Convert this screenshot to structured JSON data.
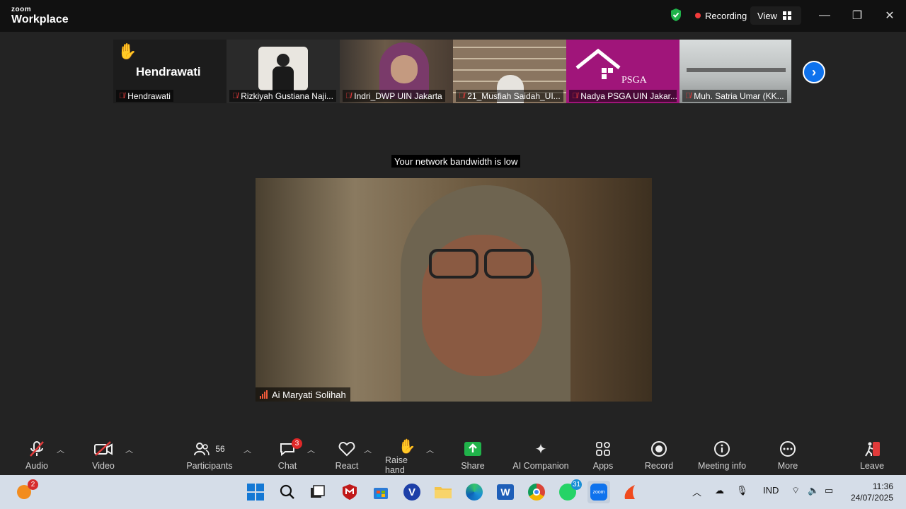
{
  "titlebar": {
    "logo_small": "zoom",
    "logo_big": "Workplace",
    "recording_label": "Recording",
    "view_label": "View",
    "minimize_glyph": "—",
    "restore_glyph": "❐",
    "close_glyph": "✕"
  },
  "gallery": {
    "tiles": [
      {
        "name": "Hendrawati",
        "display_text": "Hendrawati"
      },
      {
        "name": "Rizkiyah Gustiana Naji..."
      },
      {
        "name": "Indri_DWP UIN Jakarta"
      },
      {
        "name": "21_Musfiah Saidah_UI..."
      },
      {
        "name": "Nadya PSGA UIN Jakar...",
        "logo_text": "PSGA"
      },
      {
        "name": "Muh. Satria Umar (KK..."
      }
    ],
    "next_glyph": "›"
  },
  "banner": {
    "text": "Your network bandwidth is low"
  },
  "speaker": {
    "name": "Ai Maryati Solihah"
  },
  "toolbar": {
    "audio": "Audio",
    "video": "Video",
    "participants": "Participants",
    "participants_count": "56",
    "chat": "Chat",
    "chat_badge": "3",
    "react": "React",
    "raise_hand": "Raise hand",
    "share": "Share",
    "ai_companion": "AI Companion",
    "apps": "Apps",
    "record": "Record",
    "meeting_info": "Meeting info",
    "more": "More",
    "leave": "Leave"
  },
  "taskbar": {
    "notification_badge": "2",
    "whatsapp_badge": "31",
    "language": "IND",
    "time": "11:36",
    "date": "24/07/2025"
  },
  "colors": {
    "accent": "#0e72ed",
    "recording_red": "#f23b3b",
    "share_green": "#20b34a",
    "psga_magenta": "#a0157a"
  }
}
